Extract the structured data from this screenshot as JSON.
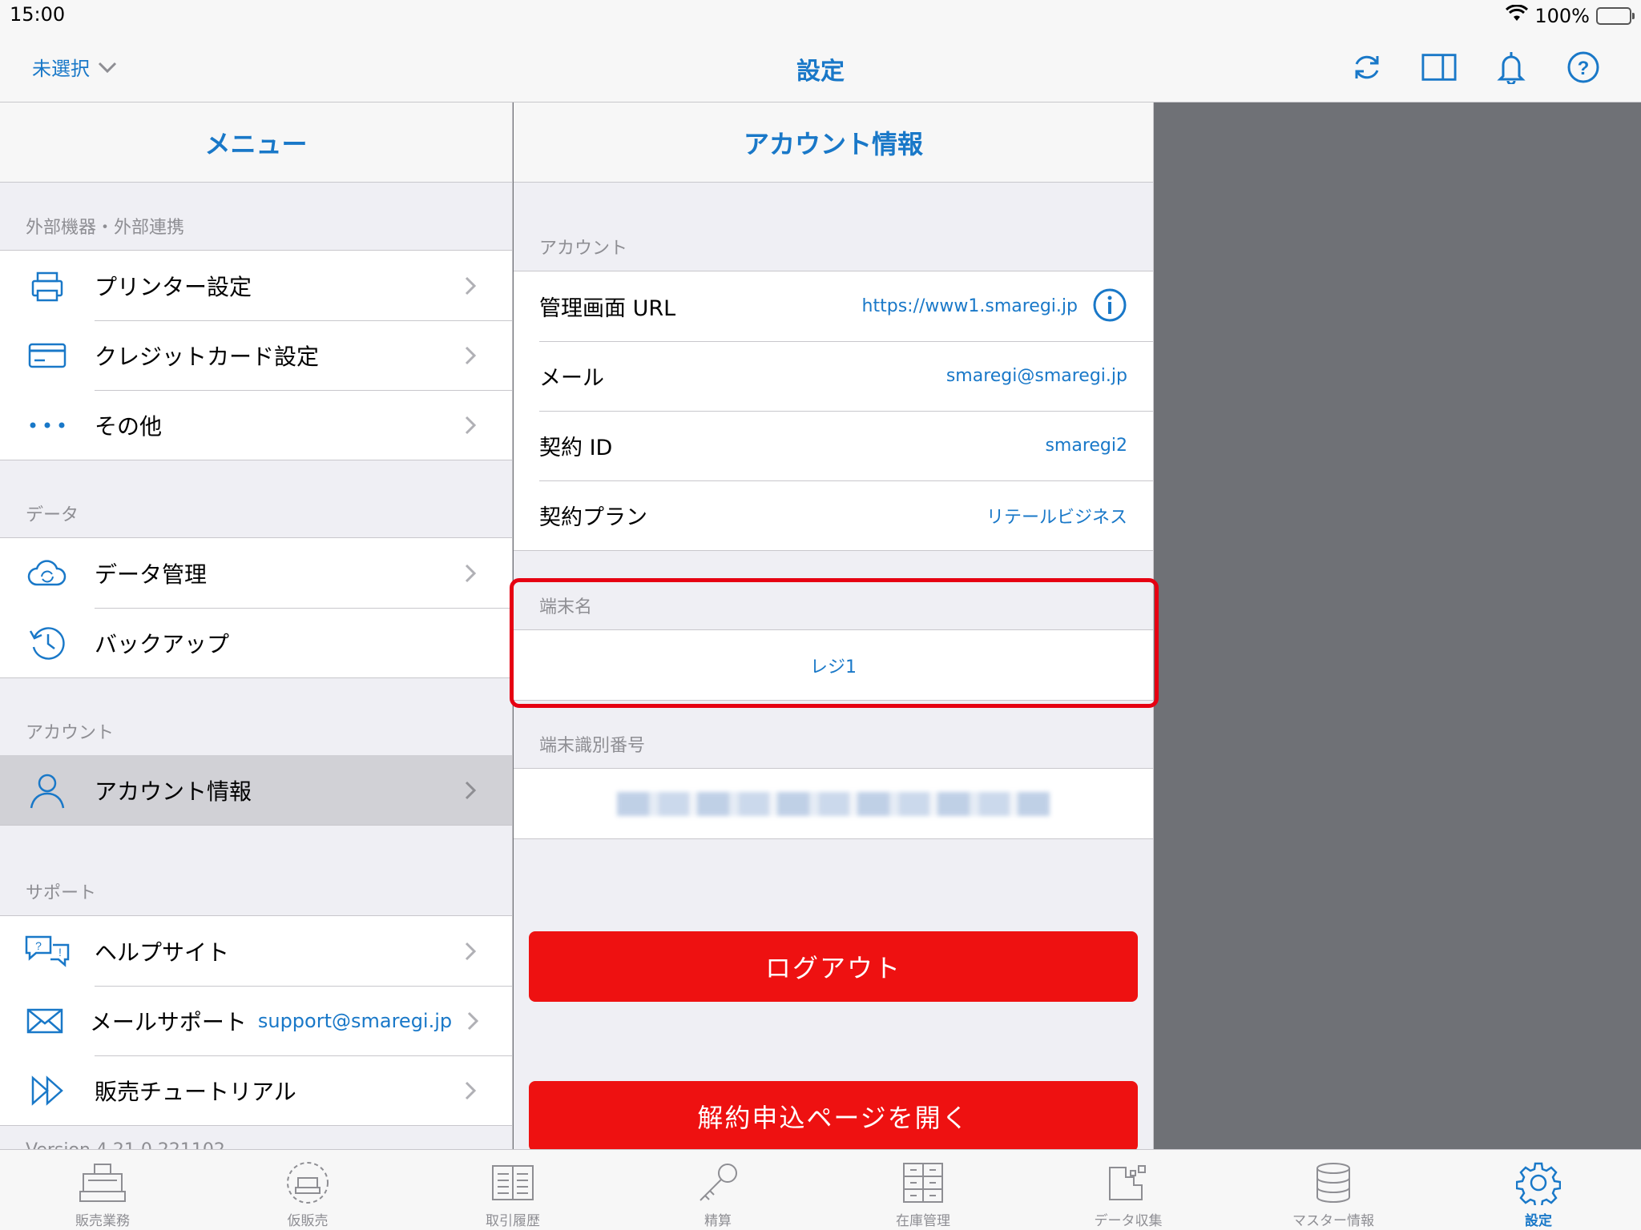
{
  "status_bar": {
    "time": "15:00",
    "battery": "100%"
  },
  "nav": {
    "shop_selector": "未選択",
    "title": "設定",
    "icons": [
      "refresh-icon",
      "split-view-icon",
      "bell-icon",
      "help-icon"
    ]
  },
  "menu": {
    "header": "メニュー",
    "sections": [
      {
        "label": "外部機器・外部連携",
        "items": [
          {
            "label": "プリンター設定",
            "icon": "printer-icon"
          },
          {
            "label": "クレジットカード設定",
            "icon": "credit-card-icon"
          },
          {
            "label": "その他",
            "icon": "more-dots-icon"
          }
        ]
      },
      {
        "label": "データ",
        "items": [
          {
            "label": "データ管理",
            "icon": "cloud-sync-icon"
          },
          {
            "label": "バックアップ",
            "icon": "history-icon"
          }
        ]
      },
      {
        "label": "アカウント",
        "items": [
          {
            "label": "アカウント情報",
            "icon": "person-icon",
            "selected": true
          }
        ]
      },
      {
        "label": "サポート",
        "items": [
          {
            "label": "ヘルプサイト",
            "icon": "help-chat-icon"
          },
          {
            "label": "メールサポート",
            "icon": "envelope-icon",
            "extra": "support@smaregi.jp"
          },
          {
            "label": "販売チュートリアル",
            "icon": "fast-forward-icon"
          }
        ]
      }
    ],
    "version": "Version 4.21.0.221102"
  },
  "detail": {
    "header": "アカウント情報",
    "account_section": {
      "label": "アカウント",
      "rows": [
        {
          "key": "管理画面 URL",
          "value": "https://www1.smaregi.jp"
        },
        {
          "key": "メール",
          "value": "smaregi@smaregi.jp"
        },
        {
          "key": "契約 ID",
          "value": "smaregi2"
        },
        {
          "key": "契約プラン",
          "value": "リテールビジネス"
        }
      ]
    },
    "terminal_name": {
      "label": "端末名",
      "value": "レジ1"
    },
    "terminal_id": {
      "label": "端末識別番号"
    },
    "logout_button": "ログアウト",
    "cancel_button": "解約申込ページを開く"
  },
  "tabbar": {
    "tabs": [
      {
        "label": "販売業務",
        "icon": "register-icon"
      },
      {
        "label": "仮販売",
        "icon": "temp-sale-icon"
      },
      {
        "label": "取引履歴",
        "icon": "receipt-list-icon"
      },
      {
        "label": "精算",
        "icon": "key-icon"
      },
      {
        "label": "在庫管理",
        "icon": "cabinet-icon"
      },
      {
        "label": "データ収集",
        "icon": "data-collect-icon"
      },
      {
        "label": "マスター情報",
        "icon": "database-icon"
      },
      {
        "label": "設定",
        "icon": "gear-icon",
        "active": true
      }
    ]
  },
  "colors": {
    "accent": "#1978c8",
    "danger": "#ee1111",
    "highlight": "#e60012",
    "selected_row": "#d1d1d6"
  }
}
